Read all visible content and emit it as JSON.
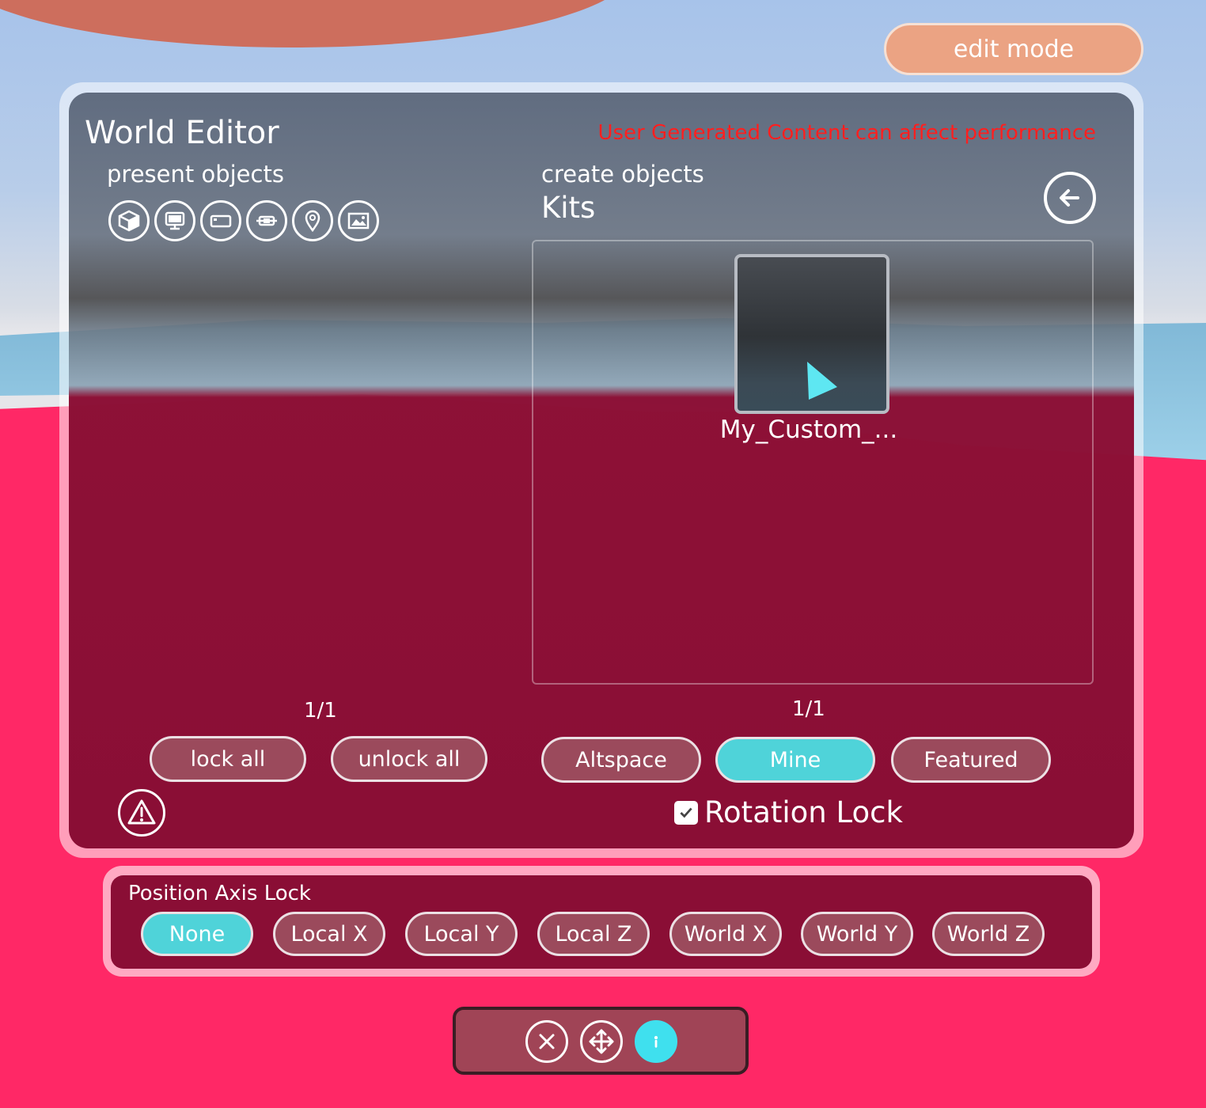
{
  "header": {
    "edit_mode_label": "edit mode"
  },
  "panel": {
    "title": "World Editor",
    "warning": "User Generated Content can affect performance",
    "present_objects_label": "present objects",
    "present_icons": [
      "cube-icon",
      "monitor-icon",
      "card-icon",
      "teleporter-icon",
      "location-pin-icon",
      "image-icon"
    ],
    "create_objects_label": "create objects",
    "section_title": "Kits",
    "kits": [
      {
        "name": "My_Custom_..."
      }
    ],
    "present_page": "1/1",
    "create_page": "1/1",
    "lock_all_label": "lock all",
    "unlock_all_label": "unlock all",
    "filters": [
      {
        "label": "Altspace",
        "active": false
      },
      {
        "label": "Mine",
        "active": true
      },
      {
        "label": "Featured",
        "active": false
      }
    ],
    "rotation_lock": {
      "label": "Rotation Lock",
      "checked": true
    }
  },
  "axis_lock": {
    "label": "Position Axis Lock",
    "options": [
      {
        "label": "None",
        "active": true
      },
      {
        "label": "Local X",
        "active": false
      },
      {
        "label": "Local Y",
        "active": false
      },
      {
        "label": "Local Z",
        "active": false
      },
      {
        "label": "World X",
        "active": false
      },
      {
        "label": "World Y",
        "active": false
      },
      {
        "label": "World Z",
        "active": false
      }
    ]
  },
  "toolbar": {
    "tools": [
      "close-icon",
      "move-icon",
      "info-icon"
    ]
  },
  "colors": {
    "accent_active": "#4fd3d9",
    "panel_bg": "#8a0e35",
    "warning": "#ff1f1f",
    "edit_mode": "#eba383"
  }
}
